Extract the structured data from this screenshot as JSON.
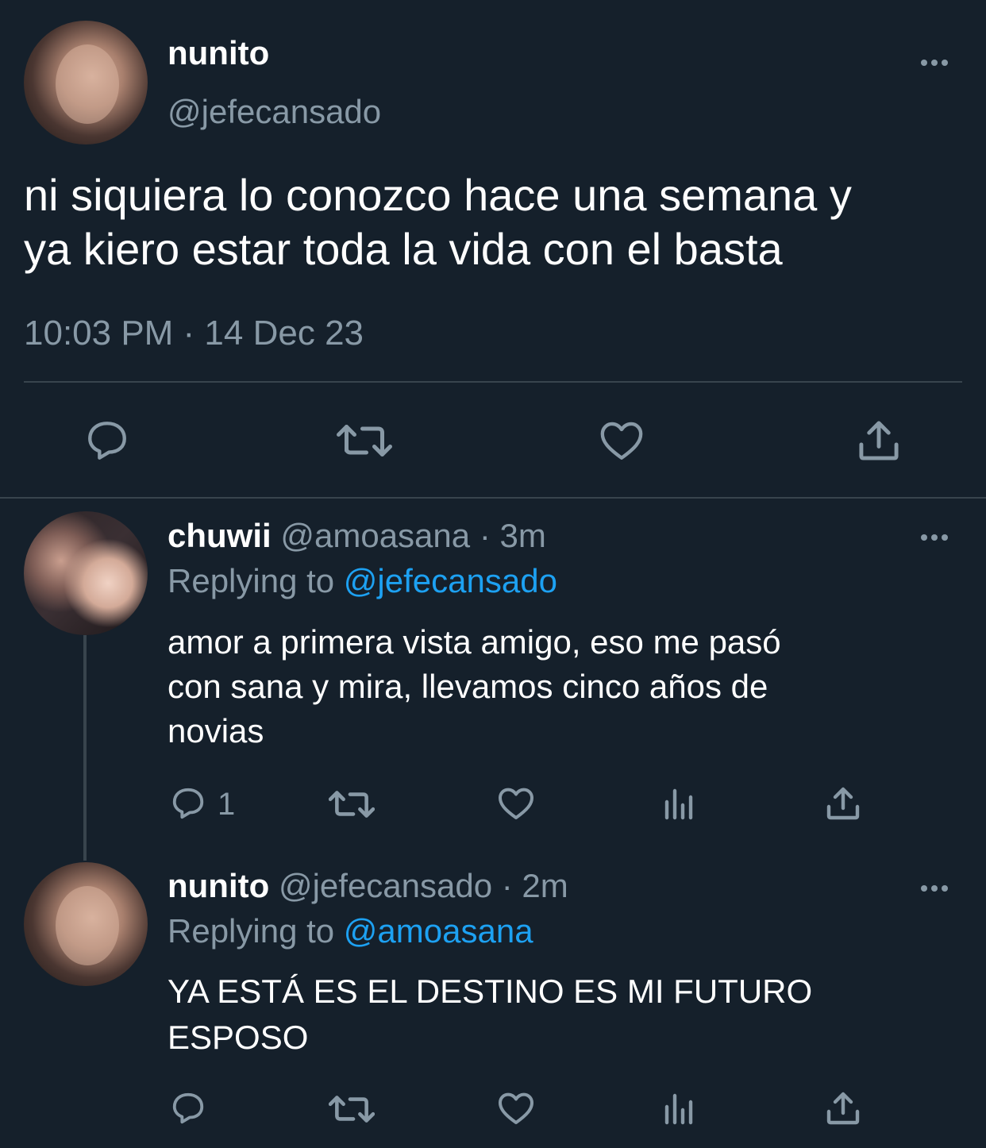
{
  "main_tweet": {
    "display_name": "nunito",
    "handle": "@jefecansado",
    "text_line1": "ni siquiera lo conozco hace una semana y",
    "text_line2": "ya kiero estar toda la vida con el basta",
    "timestamp": "10:03 PM · 14 Dec 23",
    "actions": [
      "reply-icon",
      "retweet-icon",
      "like-icon",
      "share-icon"
    ]
  },
  "replies": [
    {
      "display_name": "chuwii",
      "handle": "@amoasana",
      "time": "· 3m",
      "replying_label": "Replying to",
      "replying_to": "@jefecansado",
      "text_line1": "amor a primera vista amigo, eso me pasó",
      "text_line2": "con sana y mira, llevamos cinco años de",
      "text_line3": "novias",
      "reply_count": "1"
    },
    {
      "display_name": "nunito",
      "handle": "@jefecansado",
      "time": "· 2m",
      "replying_label": "Replying to",
      "replying_to": "@amoasana",
      "text_line1": "YA ESTÁ ES EL DESTINO ES MI FUTURO",
      "text_line2": "ESPOSO",
      "text_line3": ""
    }
  ],
  "colors": {
    "background": "#15202b",
    "muted": "#8899a6",
    "link": "#1da1f2",
    "divider": "#38444d"
  }
}
